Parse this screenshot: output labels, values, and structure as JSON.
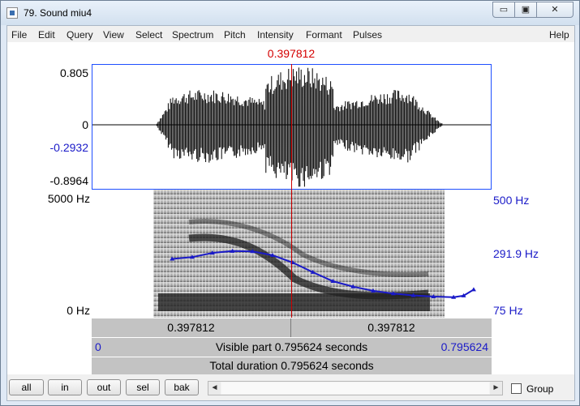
{
  "window": {
    "title": "79. Sound miu4",
    "min_glyph": "▭",
    "max_glyph": "▣",
    "close_glyph": "✕"
  },
  "menu": [
    "File",
    "Edit",
    "Query",
    "View",
    "Select",
    "Spectrum",
    "Pitch",
    "Intensity",
    "Formant",
    "Pulses"
  ],
  "help_label": "Help",
  "cursor_time": "0.397812",
  "waveform": {
    "amp_max": "0.805",
    "amp_zero": "0",
    "amp_cursor": "-0.2932",
    "amp_min": "-0.8964"
  },
  "spectrogram": {
    "freq_top": "5000 Hz",
    "freq_bottom": "0 Hz",
    "pitch_top": "500 Hz",
    "pitch_cursor": "291.9 Hz",
    "pitch_bottom": "75 Hz"
  },
  "time_bars": {
    "left_segment": "0.397812",
    "right_segment": "0.397812",
    "visible_start": "0",
    "visible_label": "Visible part 0.795624 seconds",
    "visible_end": "0.795624",
    "total_label": "Total duration 0.795624 seconds"
  },
  "zoom_buttons": [
    "all",
    "in",
    "out",
    "sel",
    "bak"
  ],
  "scroll": {
    "left_arrow": "◄",
    "right_arrow": "►"
  },
  "group_label": "Group",
  "colors": {
    "cursor": "#d40000",
    "pitch": "#1a1ac8",
    "frame": "#1f4fff"
  },
  "chart_data": {
    "type": "line",
    "x": [
      0.16,
      0.2,
      0.24,
      0.28,
      0.32,
      0.36,
      0.4,
      0.44,
      0.48,
      0.52,
      0.56,
      0.6,
      0.64,
      0.68,
      0.72,
      0.74,
      0.76
    ],
    "series": [
      {
        "values": [
          270,
          276,
          290,
          296,
          295,
          282,
          258,
          226,
          196,
          178,
          164,
          155,
          149,
          145,
          143,
          148,
          168
        ]
      }
    ],
    "xlim": [
      0,
      0.795624
    ],
    "ylim": [
      75,
      500
    ]
  }
}
